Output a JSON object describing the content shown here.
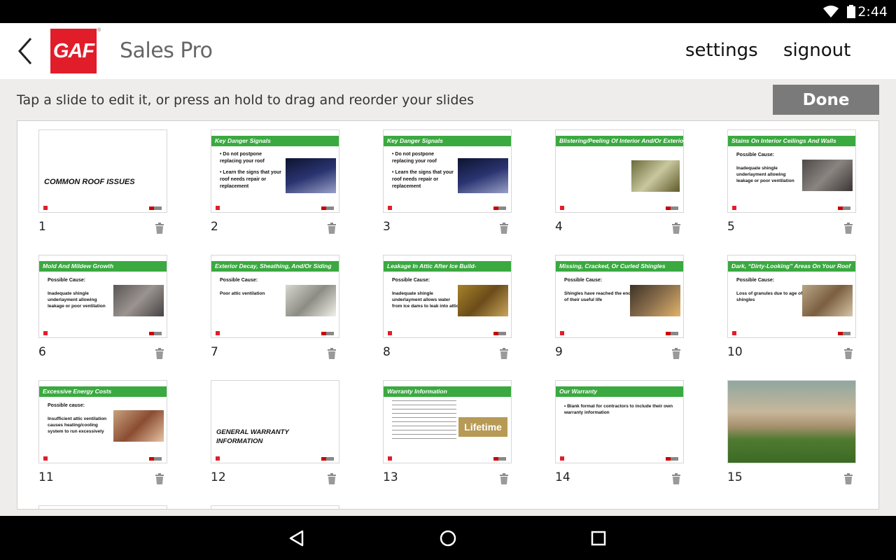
{
  "status_bar": {
    "time": "2:44",
    "wifi_icon": "wifi-icon",
    "battery_icon": "battery-icon"
  },
  "app_bar": {
    "back_icon": "back-arrow-icon",
    "logo_text": "GAF",
    "title": "Sales Pro",
    "settings_label": "settings",
    "signout_label": "signout"
  },
  "instruction": "Tap a slide to edit it, or press an hold to drag and reorder your slides",
  "done_label": "Done",
  "colors": {
    "brand_red": "#e21d2a",
    "slide_green": "#3aa940",
    "done_gray": "#7a7a7a"
  },
  "slides": [
    {
      "number": "1",
      "layout": "title",
      "title": "COMMON ROOF ISSUES"
    },
    {
      "number": "2",
      "layout": "bullets",
      "header": "Key Danger Signals",
      "bullets": [
        "• Do not postpone replacing your roof",
        "• Learn the signs that your roof needs repair or replacement"
      ]
    },
    {
      "number": "3",
      "layout": "bullets",
      "header": "Key Danger Signals",
      "bullets": [
        "• Do not postpone replacing your roof",
        "• Learn the signs that your roof needs repair or replacement"
      ]
    },
    {
      "number": "4",
      "layout": "image",
      "header": "Blistering/Peeling Of Interior And/Or Exterior Paint"
    },
    {
      "number": "5",
      "layout": "cause",
      "header": "Stains On Interior Ceilings And Walls",
      "cause": "Possible Cause:",
      "text": "Inadequate shingle underlayment allowing leakage or poor ventilation"
    },
    {
      "number": "6",
      "layout": "cause",
      "header": "Mold And Mildew Growth",
      "cause": "Possible Cause:",
      "text": "Inadequate shingle underlayment allowing leakage or poor ventilation"
    },
    {
      "number": "7",
      "layout": "cause",
      "header": "Exterior Decay, Sheathing, And/Or Siding",
      "cause": "Possible Cause:",
      "text": "Poor attic ventilation"
    },
    {
      "number": "8",
      "layout": "cause",
      "header": "Leakage In Attic After Ice Build-",
      "cause": "Possible Cause:",
      "text": "Inadequate shingle underlayment allows water from ice dams to leak into attic"
    },
    {
      "number": "9",
      "layout": "cause",
      "header": "Missing, Cracked, Or Curled Shingles",
      "cause": "Possible Cause:",
      "text": "Shingles have reached the end of their useful life"
    },
    {
      "number": "10",
      "layout": "cause",
      "header": "Dark, “Dirty-Looking” Areas On Your Roof",
      "cause": "Possible Cause:",
      "text": "Loss of granules due to age of shingles"
    },
    {
      "number": "11",
      "layout": "cause",
      "header": "Excessive Energy Costs",
      "cause": "Possible cause:",
      "text": "Insufficient attic ventilation causes heating/cooling system to run excessively"
    },
    {
      "number": "12",
      "layout": "title2",
      "title": "GENERAL WARRANTY INFORMATION"
    },
    {
      "number": "13",
      "layout": "warranty",
      "header": "Warranty Information",
      "badge": "Lifetime"
    },
    {
      "number": "14",
      "layout": "bullets2",
      "header": "Our Warranty",
      "text": "• Blank format for contractors to include their own warranty information"
    },
    {
      "number": "15",
      "layout": "photo"
    }
  ],
  "nav_bar": {
    "back": "nav-back-icon",
    "home": "nav-home-icon",
    "recents": "nav-recents-icon"
  }
}
